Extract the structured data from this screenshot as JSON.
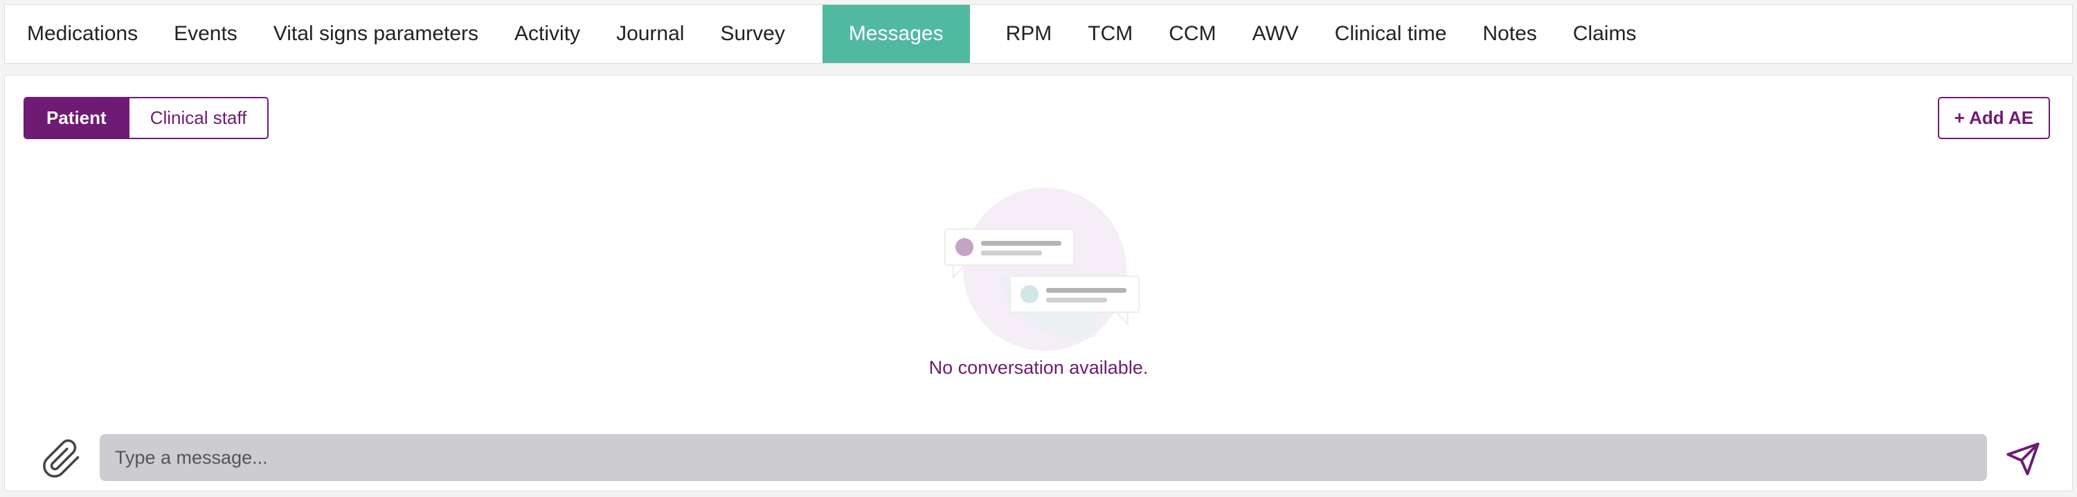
{
  "tabs": [
    {
      "label": "Medications",
      "active": false
    },
    {
      "label": "Events",
      "active": false
    },
    {
      "label": "Vital signs parameters",
      "active": false
    },
    {
      "label": "Activity",
      "active": false
    },
    {
      "label": "Journal",
      "active": false
    },
    {
      "label": "Survey",
      "active": false
    },
    {
      "label": "Messages",
      "active": true
    },
    {
      "label": "RPM",
      "active": false
    },
    {
      "label": "TCM",
      "active": false
    },
    {
      "label": "CCM",
      "active": false
    },
    {
      "label": "AWV",
      "active": false
    },
    {
      "label": "Clinical time",
      "active": false
    },
    {
      "label": "Notes",
      "active": false
    },
    {
      "label": "Claims",
      "active": false
    }
  ],
  "conversation_toggle": {
    "patient_label": "Patient",
    "staff_label": "Clinical staff",
    "selected": "Patient"
  },
  "add_ae_label": "+ Add AE",
  "empty_state": {
    "icon": "chat-bubbles-illustration",
    "text": "No conversation available."
  },
  "composer": {
    "placeholder": "Type a message...",
    "value": "",
    "attach_icon": "paperclip-icon",
    "send_icon": "send-icon"
  },
  "colors": {
    "accent": "#6f1a74",
    "active_tab": "#52b9a1",
    "input_bg": "#cdcdd1"
  }
}
